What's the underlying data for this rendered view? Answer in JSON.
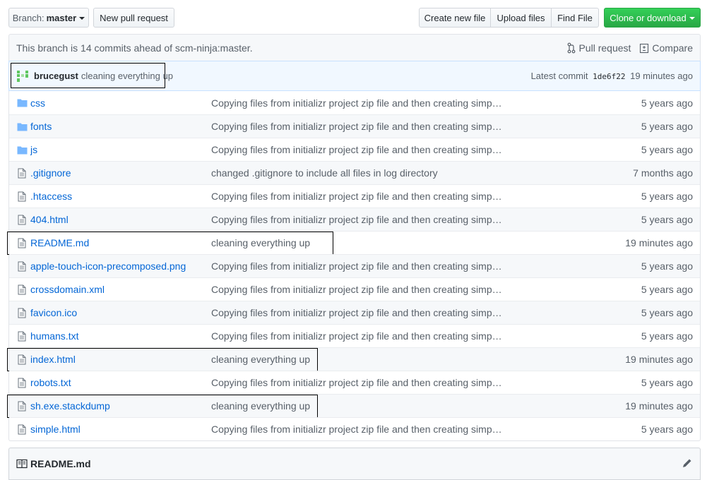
{
  "toolbar": {
    "branch_prefix": "Branch:",
    "branch_name": "master",
    "new_pr": "New pull request",
    "create_file": "Create new file",
    "upload_files": "Upload files",
    "find_file": "Find File",
    "clone_download": "Clone or download"
  },
  "branch_info": {
    "text": "This branch is 14 commits ahead of scm-ninja:master.",
    "pull_request": "Pull request",
    "compare": "Compare"
  },
  "latest_commit": {
    "author": "brucegust",
    "message": "cleaning everything up",
    "label": "Latest commit",
    "sha": "1de6f22",
    "age": "19 minutes ago"
  },
  "files": [
    {
      "type": "folder",
      "name": "css",
      "message": "Copying files from initializr project zip file and then creating simp…",
      "age": "5 years ago"
    },
    {
      "type": "folder",
      "name": "fonts",
      "message": "Copying files from initializr project zip file and then creating simp…",
      "age": "5 years ago"
    },
    {
      "type": "folder",
      "name": "js",
      "message": "Copying files from initializr project zip file and then creating simp…",
      "age": "5 years ago"
    },
    {
      "type": "file",
      "name": ".gitignore",
      "message": "changed .gitignore to include all files in log directory",
      "age": "7 months ago"
    },
    {
      "type": "file",
      "name": ".htaccess",
      "message": "Copying files from initializr project zip file and then creating simp…",
      "age": "5 years ago"
    },
    {
      "type": "file",
      "name": "404.html",
      "message": "Copying files from initializr project zip file and then creating simp…",
      "age": "5 years ago"
    },
    {
      "type": "file",
      "name": "README.md",
      "message": "cleaning everything up",
      "age": "19 minutes ago"
    },
    {
      "type": "file",
      "name": "apple-touch-icon-precomposed.png",
      "message": "Copying files from initializr project zip file and then creating simp…",
      "age": "5 years ago"
    },
    {
      "type": "file",
      "name": "crossdomain.xml",
      "message": "Copying files from initializr project zip file and then creating simp…",
      "age": "5 years ago"
    },
    {
      "type": "file",
      "name": "favicon.ico",
      "message": "Copying files from initializr project zip file and then creating simp…",
      "age": "5 years ago"
    },
    {
      "type": "file",
      "name": "humans.txt",
      "message": "Copying files from initializr project zip file and then creating simp…",
      "age": "5 years ago"
    },
    {
      "type": "file",
      "name": "index.html",
      "message": "cleaning everything up",
      "age": "19 minutes ago"
    },
    {
      "type": "file",
      "name": "robots.txt",
      "message": "Copying files from initializr project zip file and then creating simp…",
      "age": "5 years ago"
    },
    {
      "type": "file",
      "name": "sh.exe.stackdump",
      "message": "cleaning everything up",
      "age": "19 minutes ago"
    },
    {
      "type": "file",
      "name": "simple.html",
      "message": "Copying files from initializr project zip file and then creating simp…",
      "age": "5 years ago"
    }
  ],
  "readme": {
    "title": "README.md"
  },
  "colors": {
    "link": "#0366d6",
    "muted": "#586069",
    "green": "#28a745",
    "folder": "#79b8ff"
  }
}
